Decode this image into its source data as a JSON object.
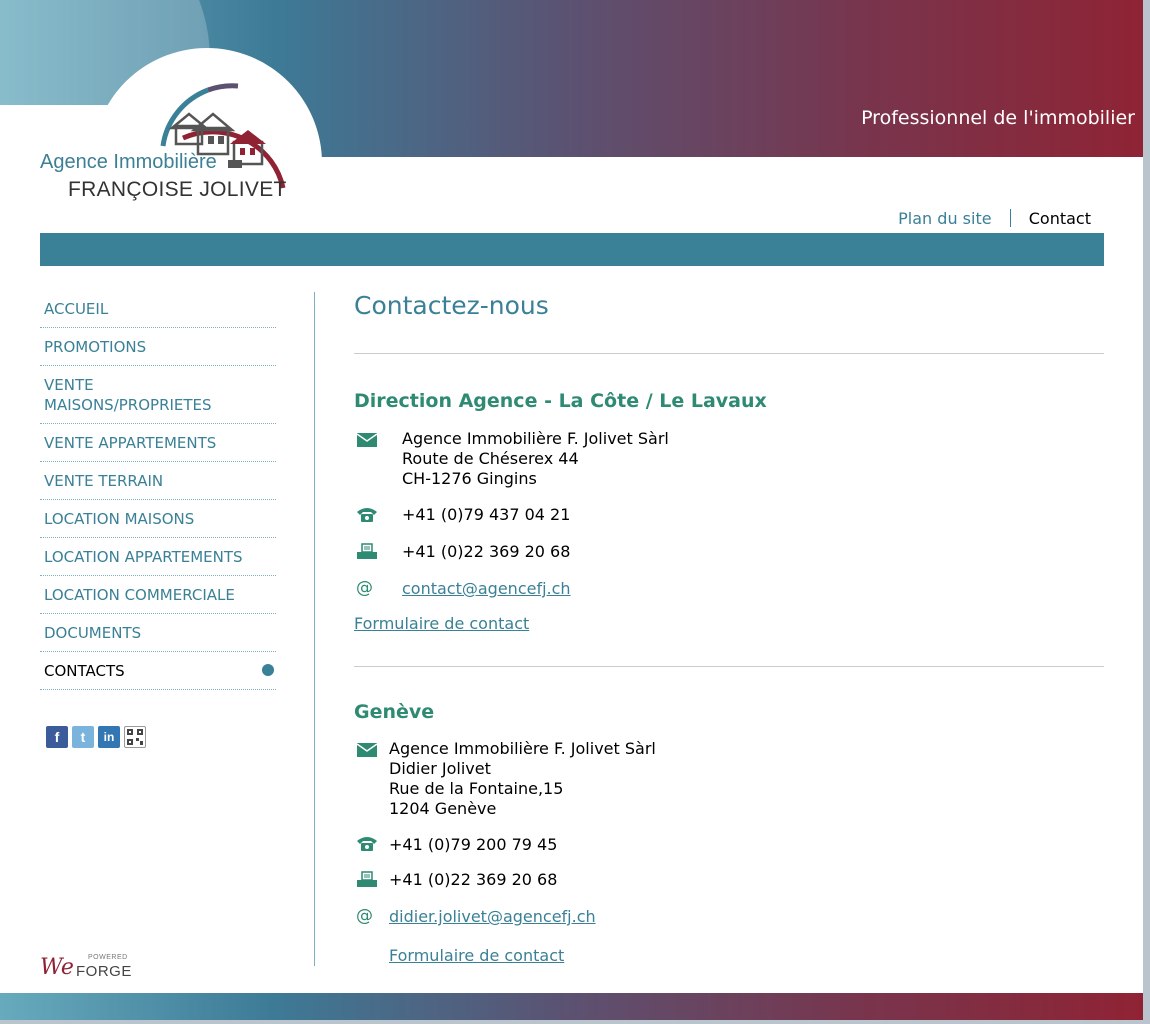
{
  "header": {
    "tagline": "Professionnel de l'immobilier",
    "logo_line1": "Agence Immobilière",
    "logo_line2": "FRANÇOISE JOLIVET"
  },
  "toplinks": {
    "site_map": "Plan du site",
    "contact": "Contact"
  },
  "sidebar": {
    "items": [
      {
        "label": "ACCUEIL"
      },
      {
        "label": "PROMOTIONS"
      },
      {
        "label_line1": "VENTE",
        "label_line2": "MAISONS/PROPRIETES"
      },
      {
        "label": "VENTE APPARTEMENTS"
      },
      {
        "label": "VENTE TERRAIN"
      },
      {
        "label": "LOCATION MAISONS"
      },
      {
        "label": "LOCATION APPARTEMENTS"
      },
      {
        "label": "LOCATION COMMERCIALE"
      },
      {
        "label": "DOCUMENTS"
      },
      {
        "label": "CONTACTS"
      }
    ],
    "social_icons": [
      "facebook-icon",
      "twitter-icon",
      "linkedin-icon",
      "qr-code-icon"
    ]
  },
  "powered_by": {
    "small": "POWERED",
    "brand_web": "We",
    "brand_forge": "FORGE"
  },
  "main": {
    "title": "Contactez-nous",
    "sections": [
      {
        "title": "Direction Agence - La Côte / Le Lavaux",
        "address": [
          "Agence Immobilière F. Jolivet Sàrl",
          "Route de Chéserex 44",
          "CH-1276 Gingins"
        ],
        "phone": "+41 (0)79 437 04 21",
        "fax": "+41 (0)22 369 20 68",
        "email": "contact@agencefj.ch",
        "form_link": "Formulaire de contact"
      },
      {
        "title": "Genève",
        "address": [
          "Agence Immobilière F. Jolivet Sàrl",
          "Didier Jolivet",
          "Rue de la Fontaine,15",
          "1204 Genève"
        ],
        "phone": "+41 (0)79 200 79 45",
        "fax": "+41 (0)22 369 20 68",
        "email": "didier.jolivet@agencefj.ch",
        "form_link": "Formulaire de contact"
      }
    ]
  },
  "colors": {
    "accent": "#3a8096",
    "section_title": "#2e8a72",
    "brand_red": "#8f2334"
  }
}
